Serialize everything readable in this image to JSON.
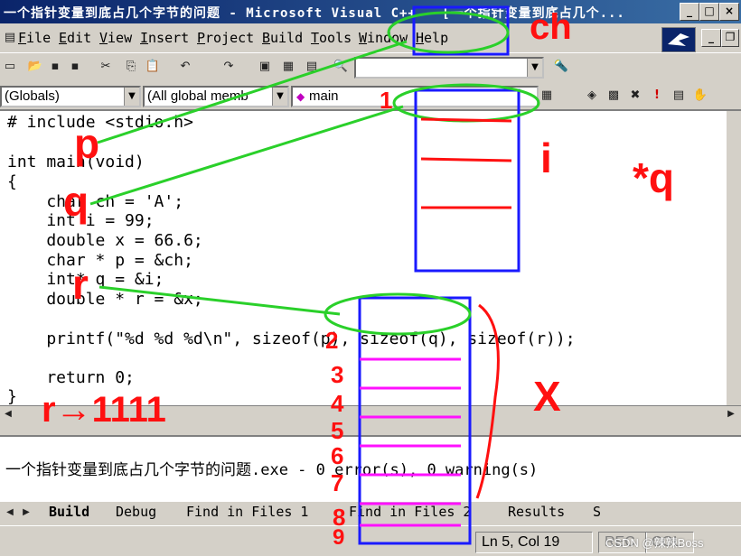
{
  "window": {
    "title": "一个指针变量到底占几个字节的问题 - Microsoft Visual C++ - [一个指针变量到底占几个..."
  },
  "menu": [
    "File",
    "Edit",
    "View",
    "Insert",
    "Project",
    "Build",
    "Tools",
    "Window",
    "Help"
  ],
  "combos": {
    "scope": "(Globals)",
    "members": "(All global memb",
    "function": "main"
  },
  "code": [
    "# include <stdio.h>",
    "",
    "int main(void)",
    "{",
    "    char ch = 'A';",
    "    int i = 99;",
    "    double x = 66.6;",
    "    char * p = &ch;",
    "    int* q = &i;",
    "    double * r = &x;",
    "",
    "    printf(\"%d %d %d\\n\", sizeof(p), sizeof(q), sizeof(r));",
    "",
    "    return 0;",
    "}"
  ],
  "output": {
    "line": "一个指针变量到底占几个字节的问题.exe - 0 error(s), 0 warning(s)"
  },
  "tabs": [
    "Build",
    "Debug",
    "Find in Files 1",
    "Find in Files 2",
    "Results",
    "S"
  ],
  "status": {
    "position": "Ln 5, Col 19",
    "rec": "REC",
    "col": "COL",
    "watermark": "CSDN @辣辣Boss"
  },
  "annotations": {
    "ch": "ch",
    "i": "i",
    "star_q": "*q",
    "x": "X",
    "p": "p",
    "q": "q",
    "r": "r",
    "r_value": "r→1111",
    "numbers": [
      "1",
      "2",
      "3",
      "4",
      "5",
      "6",
      "7",
      "8",
      "9"
    ]
  },
  "colors": {
    "title_bg": "#0a246a",
    "annotation_red": "#ff1010",
    "annotation_green": "#2ad02a",
    "annotation_blue": "#1a1aff",
    "annotation_magenta": "#ff10ff"
  }
}
